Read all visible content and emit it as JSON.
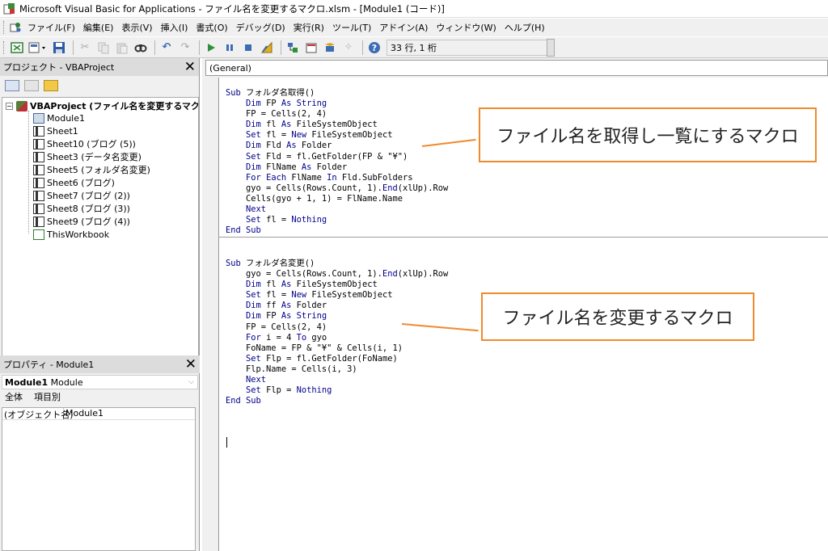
{
  "window": {
    "title": "Microsoft Visual Basic for Applications - ファイル名を変更するマクロ.xlsm - [Module1 (コード)]"
  },
  "menu": [
    "ファイル(F)",
    "編集(E)",
    "表示(V)",
    "挿入(I)",
    "書式(O)",
    "デバッグ(D)",
    "実行(R)",
    "ツール(T)",
    "アドイン(A)",
    "ウィンドウ(W)",
    "ヘルプ(H)"
  ],
  "toolbar": {
    "position": "33 行, 1 桁"
  },
  "project_panel": {
    "title": "プロジェクト - VBAProject",
    "root": "VBAProject (ファイル名を変更するマクロ",
    "items": [
      "Module1",
      "Sheet1",
      "Sheet10 (ブログ (5))",
      "Sheet3 (データ名変更)",
      "Sheet5 (フォルダ名変更)",
      "Sheet6 (ブログ)",
      "Sheet7 (ブログ (2))",
      "Sheet8 (ブログ (3))",
      "Sheet9 (ブログ (4))",
      "ThisWorkbook"
    ]
  },
  "properties_panel": {
    "title": "プロパティ - Module1",
    "object_name": "Module1",
    "object_type": "Module",
    "tabs": [
      "全体",
      "項目別"
    ],
    "rows": [
      {
        "key": "(オブジェクト名)",
        "value": "Module1"
      }
    ]
  },
  "code": {
    "combo": "(General)",
    "proc1": [
      "Sub フォルダ名取得()",
      "    Dim FP As String",
      "    FP = Cells(2, 4)",
      "    Dim fl As FileSystemObject",
      "    Set fl = New FileSystemObject",
      "    Dim Fld As Folder",
      "    Set Fld = fl.GetFolder(FP & \"¥\")",
      "    Dim FlName As Folder",
      "    For Each FlName In Fld.SubFolders",
      "    gyo = Cells(Rows.Count, 1).End(xlUp).Row",
      "    Cells(gyo + 1, 1) = FlName.Name",
      "    Next",
      "    Set fl = Nothing",
      "End Sub"
    ],
    "proc2": [
      "Sub フォルダ名変更()",
      "    gyo = Cells(Rows.Count, 1).End(xlUp).Row",
      "    Dim fl As FileSystemObject",
      "    Set fl = New FileSystemObject",
      "    Dim ff As Folder",
      "    Dim FP As String",
      "    FP = Cells(2, 4)",
      "    For i = 4 To gyo",
      "    FoName = FP & \"¥\" & Cells(i, 1)",
      "    Set Flp = fl.GetFolder(FoName)",
      "    Flp.Name = Cells(i, 3)",
      "    Next",
      "    Set Flp = Nothing",
      "End Sub"
    ]
  },
  "callouts": {
    "one": "ファイル名を取得し一覧にするマクロ",
    "two": "ファイル名を変更するマクロ"
  },
  "colors": {
    "keyword": "#00008b",
    "callout_border": "#f08a2c"
  }
}
